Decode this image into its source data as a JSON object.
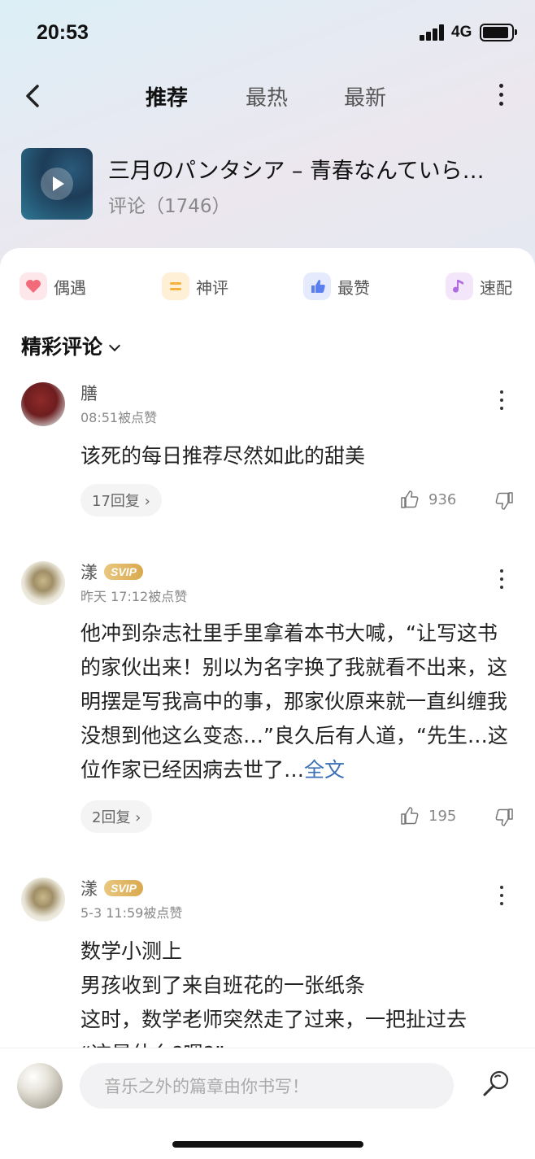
{
  "status": {
    "time": "20:53",
    "network": "4G"
  },
  "nav": {
    "tabs": [
      "推荐",
      "最热",
      "最新"
    ],
    "active_tab": "推荐"
  },
  "song": {
    "title": "三月のパンタシア – 青春なんていら…",
    "comment_count": "评论（1746）"
  },
  "filters": [
    {
      "label": "偶遇",
      "icon": "heart-icon",
      "color": "#f26b7a"
    },
    {
      "label": "神评",
      "icon": "comment-bubble-icon",
      "color": "#f5b13b"
    },
    {
      "label": "最赞",
      "icon": "thumbs-up-icon",
      "color": "#5b7ff0"
    },
    {
      "label": "速配",
      "icon": "music-note-icon",
      "color": "#b06be0"
    }
  ],
  "section_title": "精彩评论",
  "comments": [
    {
      "name": "膳",
      "meta": "08:51被点赞",
      "text": "该死的每日推荐尽然如此的甜美",
      "replies": "17回复 ›",
      "likes": "936"
    },
    {
      "name": "漾",
      "badge": "SVIP",
      "meta": "昨天 17:12被点赞",
      "text": "他冲到杂志社里手里拿着本书大喊，“让写这书的家伙出来！别以为名字换了我就看不出来，这明摆是写我高中的事，那家伙原来就一直纠缠我没想到他这么变态…”良久后有人道，“先生…这位作家已经因病去世了…",
      "full_link": "全文",
      "replies": "2回复 ›",
      "likes": "195"
    },
    {
      "name": "漾",
      "badge": "SVIP",
      "meta": "5-3 11:59被点赞",
      "lines": [
        "数学小测上",
        "男孩收到了来自班花的一张纸条",
        "这时，数学老师突然走了过来，一把扯过去",
        "“这是什么?嗯?”"
      ]
    }
  ],
  "input": {
    "placeholder": "音乐之外的篇章由你书写！"
  }
}
